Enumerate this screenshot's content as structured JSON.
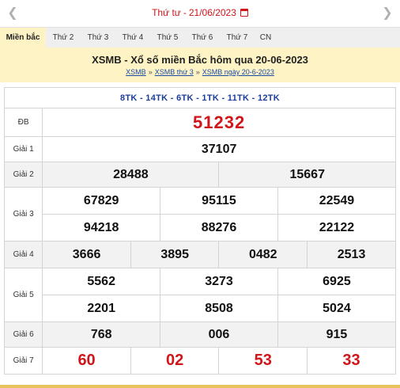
{
  "date_bar": {
    "prev_icon": "chevron-left",
    "next_icon": "chevron-right",
    "weekday": "Thứ tư",
    "separator": "-",
    "date": "21/06/2023",
    "calendar_icon": "calendar"
  },
  "tabs": [
    {
      "label": "Miền bắc",
      "active": true
    },
    {
      "label": "Thứ 2"
    },
    {
      "label": "Thứ 3"
    },
    {
      "label": "Thứ 4"
    },
    {
      "label": "Thứ 5"
    },
    {
      "label": "Thứ 6"
    },
    {
      "label": "Thứ 7"
    },
    {
      "label": "CN"
    }
  ],
  "header": {
    "title": "XSMB - Xổ số miền Bắc hôm qua 20-06-2023",
    "breadcrumbs": [
      "XSMB",
      "XSMB thứ 3",
      "XSMB ngày 20-6-2023"
    ],
    "breadcrumb_sep": "»"
  },
  "results": {
    "codes": "8TK - 14TK - 6TK - 1TK - 11TK - 12TK",
    "db": {
      "label": "ĐB",
      "numbers": [
        "51232"
      ]
    },
    "g1": {
      "label": "Giải 1",
      "numbers": [
        "37107"
      ]
    },
    "g2": {
      "label": "Giải 2",
      "numbers": [
        "28488",
        "15667"
      ]
    },
    "g3": {
      "label": "Giải 3",
      "numbers": [
        "67829",
        "95115",
        "22549",
        "94218",
        "88276",
        "22122"
      ]
    },
    "g4": {
      "label": "Giải 4",
      "numbers": [
        "3666",
        "3895",
        "0482",
        "2513"
      ]
    },
    "g5": {
      "label": "Giải 5",
      "numbers": [
        "5562",
        "3273",
        "6925",
        "2201",
        "8508",
        "5024"
      ]
    },
    "g6": {
      "label": "Giải 6",
      "numbers": [
        "768",
        "006",
        "915"
      ]
    },
    "g7": {
      "label": "Giải 7",
      "numbers": [
        "60",
        "02",
        "53",
        "33"
      ]
    }
  },
  "colors": {
    "accent_red": "#d0161a",
    "code_blue": "#1a3e9a",
    "header_bg": "#fdf3c5"
  }
}
